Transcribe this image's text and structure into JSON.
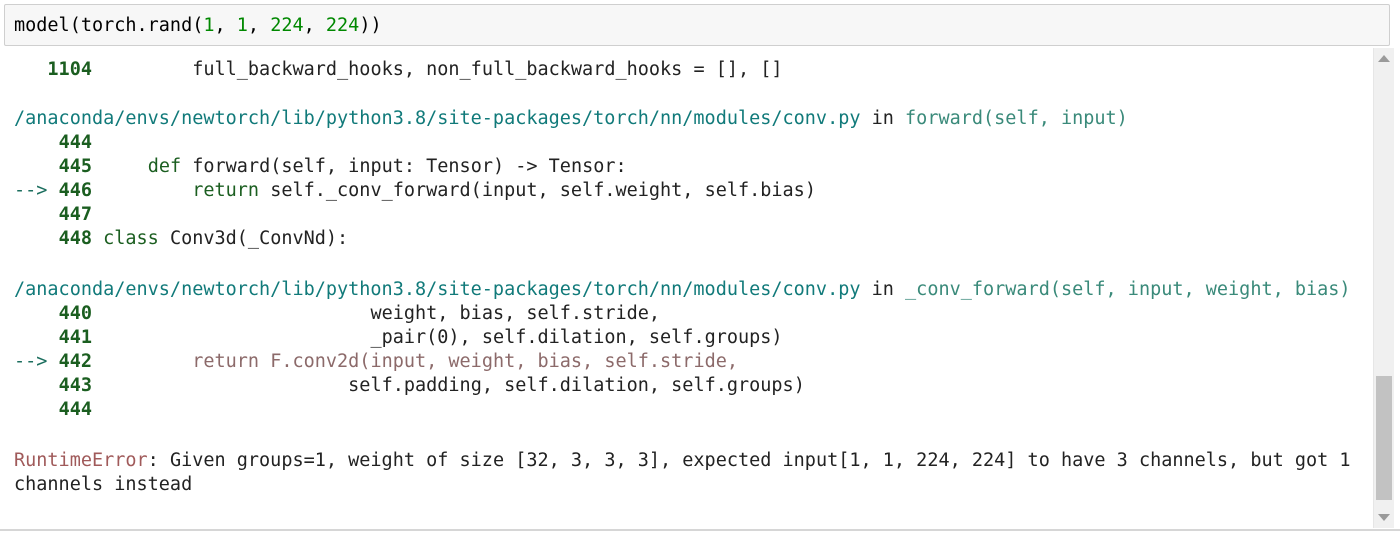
{
  "input_cell": {
    "code_prefix": "model(torch.rand(",
    "arg1": "1",
    "sep1": ", ",
    "arg2": "1",
    "sep2": ", ",
    "arg3": "224",
    "sep3": ", ",
    "arg4": "224",
    "code_suffix": "))"
  },
  "traceback": {
    "frame_top": {
      "line_1104": {
        "lineno": "1104",
        "code": "full_backward_hooks, non_full_backward_hooks = [], []"
      }
    },
    "frame_forward": {
      "path": "/anaconda/envs/newtorch/lib/python3.8/site-packages/torch/nn/modules/conv.py",
      "in_word": "in",
      "func": "forward(self, input)",
      "lines": [
        {
          "arrow": "",
          "lineno": "444",
          "code": ""
        },
        {
          "arrow": "",
          "lineno": "445",
          "keyword": "def",
          "code": "forward(self, input: Tensor) -> Tensor:"
        },
        {
          "arrow": "-->",
          "lineno": "446",
          "keyword": "return",
          "code": "self._conv_forward(input, self.weight, self.bias)"
        },
        {
          "arrow": "",
          "lineno": "447",
          "code": ""
        },
        {
          "arrow": "",
          "lineno": "448",
          "keyword": "class",
          "code": "Conv3d(_ConvNd):"
        }
      ]
    },
    "frame_conv_forward": {
      "path": "/anaconda/envs/newtorch/lib/python3.8/site-packages/torch/nn/modules/conv.py",
      "in_word": "in",
      "func": "_conv_forward(self, input, weight, bias)",
      "lines": [
        {
          "arrow": "",
          "lineno": "440",
          "code": "weight, bias, self.stride,"
        },
        {
          "arrow": "",
          "lineno": "441",
          "code": "_pair(0), self.dilation, self.groups)"
        },
        {
          "arrow": "-->",
          "lineno": "442",
          "code": "return F.conv2d(input, weight, bias, self.stride,"
        },
        {
          "arrow": "",
          "lineno": "443",
          "code": "self.padding, self.dilation, self.groups)"
        },
        {
          "arrow": "",
          "lineno": "444",
          "code": ""
        }
      ]
    },
    "error": {
      "name": "RuntimeError",
      "colon": ":",
      "message_line1": "Given groups=1, weight of size [32, 3, 3, 3], expected input[1, 1, 224, 224] to have 3 channels, but got 1",
      "message_line2": "channels instead"
    }
  },
  "colors": {
    "line_number": "#1b5e20",
    "path": "#117a7a",
    "error_name": "#a05a5a"
  },
  "icons": {
    "scroll_up": "triangle-up-icon",
    "scroll_down": "triangle-down-icon"
  }
}
